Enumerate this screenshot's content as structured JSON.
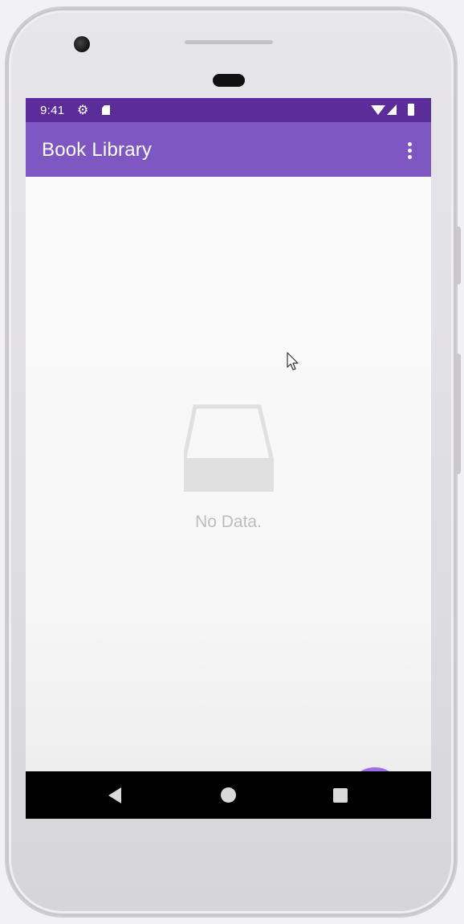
{
  "status_bar": {
    "time": "9:41",
    "icons": [
      "settings-icon",
      "sd-card-icon",
      "wifi-icon",
      "signal-icon",
      "battery-icon"
    ]
  },
  "app_bar": {
    "title": "Book Library",
    "menu_icon": "overflow-menu-icon"
  },
  "empty_state": {
    "icon": "empty-tray-icon",
    "message": "No Data."
  },
  "fab": {
    "label": "+",
    "icon": "add-icon"
  },
  "nav_bar": {
    "items": [
      "back-icon",
      "home-icon",
      "recents-icon"
    ]
  },
  "colors": {
    "status_bar": "#5b2d9a",
    "app_bar": "#7e57c2",
    "fab": "#9c6ee6",
    "background": "#fafafa",
    "empty_text": "#bdbdbd"
  }
}
